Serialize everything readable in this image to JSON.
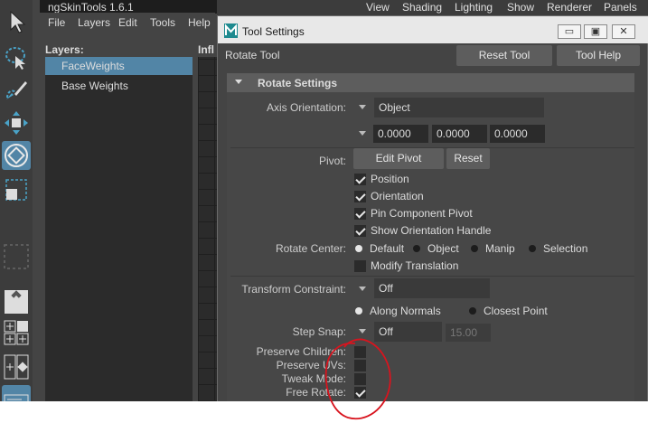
{
  "ng_window": {
    "title": "ngSkinTools 1.6.1",
    "menu": [
      "File",
      "Layers",
      "Edit",
      "Tools",
      "Help"
    ],
    "layers_label": "Layers:",
    "influences_label": "Infl",
    "layers": [
      {
        "label": "FaceWeights",
        "selected": true
      },
      {
        "label": "Base Weights",
        "selected": false
      }
    ]
  },
  "maya_menu": [
    "View",
    "Shading",
    "Lighting",
    "Show",
    "Renderer",
    "Panels"
  ],
  "tool_settings": {
    "window_title": "Tool Settings",
    "tool_name": "Rotate Tool",
    "reset_tool": "Reset Tool",
    "tool_help": "Tool Help",
    "section": "Rotate Settings",
    "axis_orientation": {
      "label": "Axis Orientation:",
      "value": "Object"
    },
    "axis_values": [
      "0.0000",
      "0.0000",
      "0.0000"
    ],
    "pivot": {
      "label": "Pivot:",
      "edit_pivot": "Edit Pivot",
      "reset": "Reset"
    },
    "pivot_options": [
      {
        "label": "Position",
        "checked": true
      },
      {
        "label": "Orientation",
        "checked": true
      },
      {
        "label": "Pin Component Pivot",
        "checked": true
      },
      {
        "label": "Show Orientation Handle",
        "checked": true
      }
    ],
    "rotate_center": {
      "label": "Rotate Center:",
      "options": [
        {
          "label": "Default",
          "selected": true
        },
        {
          "label": "Object",
          "selected": false
        },
        {
          "label": "Manip",
          "selected": false
        },
        {
          "label": "Selection",
          "selected": false
        }
      ]
    },
    "modify_translation": {
      "label": "Modify Translation",
      "checked": false
    },
    "transform_constraint": {
      "label": "Transform Constraint:",
      "value": "Off",
      "options": [
        {
          "label": "Along Normals",
          "selected": true
        },
        {
          "label": "Closest Point",
          "selected": false
        }
      ]
    },
    "step_snap": {
      "label": "Step Snap:",
      "value": "Off",
      "amount": "15.00"
    },
    "toggles": [
      {
        "label": "Preserve Children:",
        "checked": false
      },
      {
        "label": "Preserve UVs:",
        "checked": false
      },
      {
        "label": "Tweak Mode:",
        "checked": false
      },
      {
        "label": "Free Rotate:",
        "checked": true
      }
    ]
  },
  "colors": {
    "selection": "#5285a6",
    "annotation": "#d8141e"
  }
}
